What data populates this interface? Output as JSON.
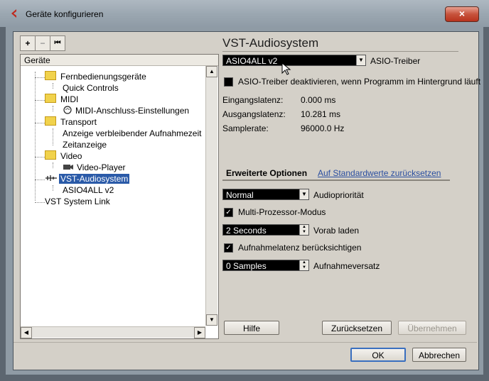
{
  "window": {
    "title": "Geräte konfigurieren",
    "close_label": "×"
  },
  "toolbar": {
    "add": "+",
    "remove": "−",
    "reset": "⏮"
  },
  "tree": {
    "header": "Geräte",
    "items": [
      "Fernbedienungsgeräte",
      "Quick Controls",
      "MIDI",
      "MIDI-Anschluss-Einstellungen",
      "Transport",
      "Anzeige verbleibender Aufnahmezeit",
      "Zeitanzeige",
      "Video",
      "Video-Player",
      "VST-Audiosystem",
      "ASIO4ALL v2",
      "VST System Link"
    ]
  },
  "panel": {
    "heading": "VST-Audiosystem",
    "asio_driver_value": "ASIO4ALL v2",
    "asio_driver_label": "ASIO-Treiber",
    "deactivate_label": "ASIO-Treiber deaktivieren, wenn Programm im Hintergrund läuft",
    "input_latency_label": "Eingangslatenz:",
    "input_latency_value": "0.000 ms",
    "output_latency_label": "Ausgangslatenz:",
    "output_latency_value": "10.281 ms",
    "samplerate_label": "Samplerate:",
    "samplerate_value": "96000.0 Hz",
    "tab_advanced": "Erweiterte Optionen",
    "tab_defaults": "Auf Standardwerte zurücksetzen",
    "priority_value": "Normal",
    "priority_label": "Audiopriorität",
    "multiproc_label": "Multi-Prozessor-Modus",
    "preload_value": "2 Seconds",
    "preload_label": "Vorab laden",
    "reclatency_label": "Aufnahmelatenz berücksichtigen",
    "offset_value": "0 Samples",
    "offset_label": "Aufnahmeversatz"
  },
  "buttons": {
    "help": "Hilfe",
    "reset": "Zurücksetzen",
    "apply": "Übernehmen",
    "ok": "OK",
    "cancel": "Abbrechen"
  },
  "colors": {
    "accent": "#3a6fbf",
    "link": "#2a4ea0",
    "folder": "#f1d24c"
  }
}
